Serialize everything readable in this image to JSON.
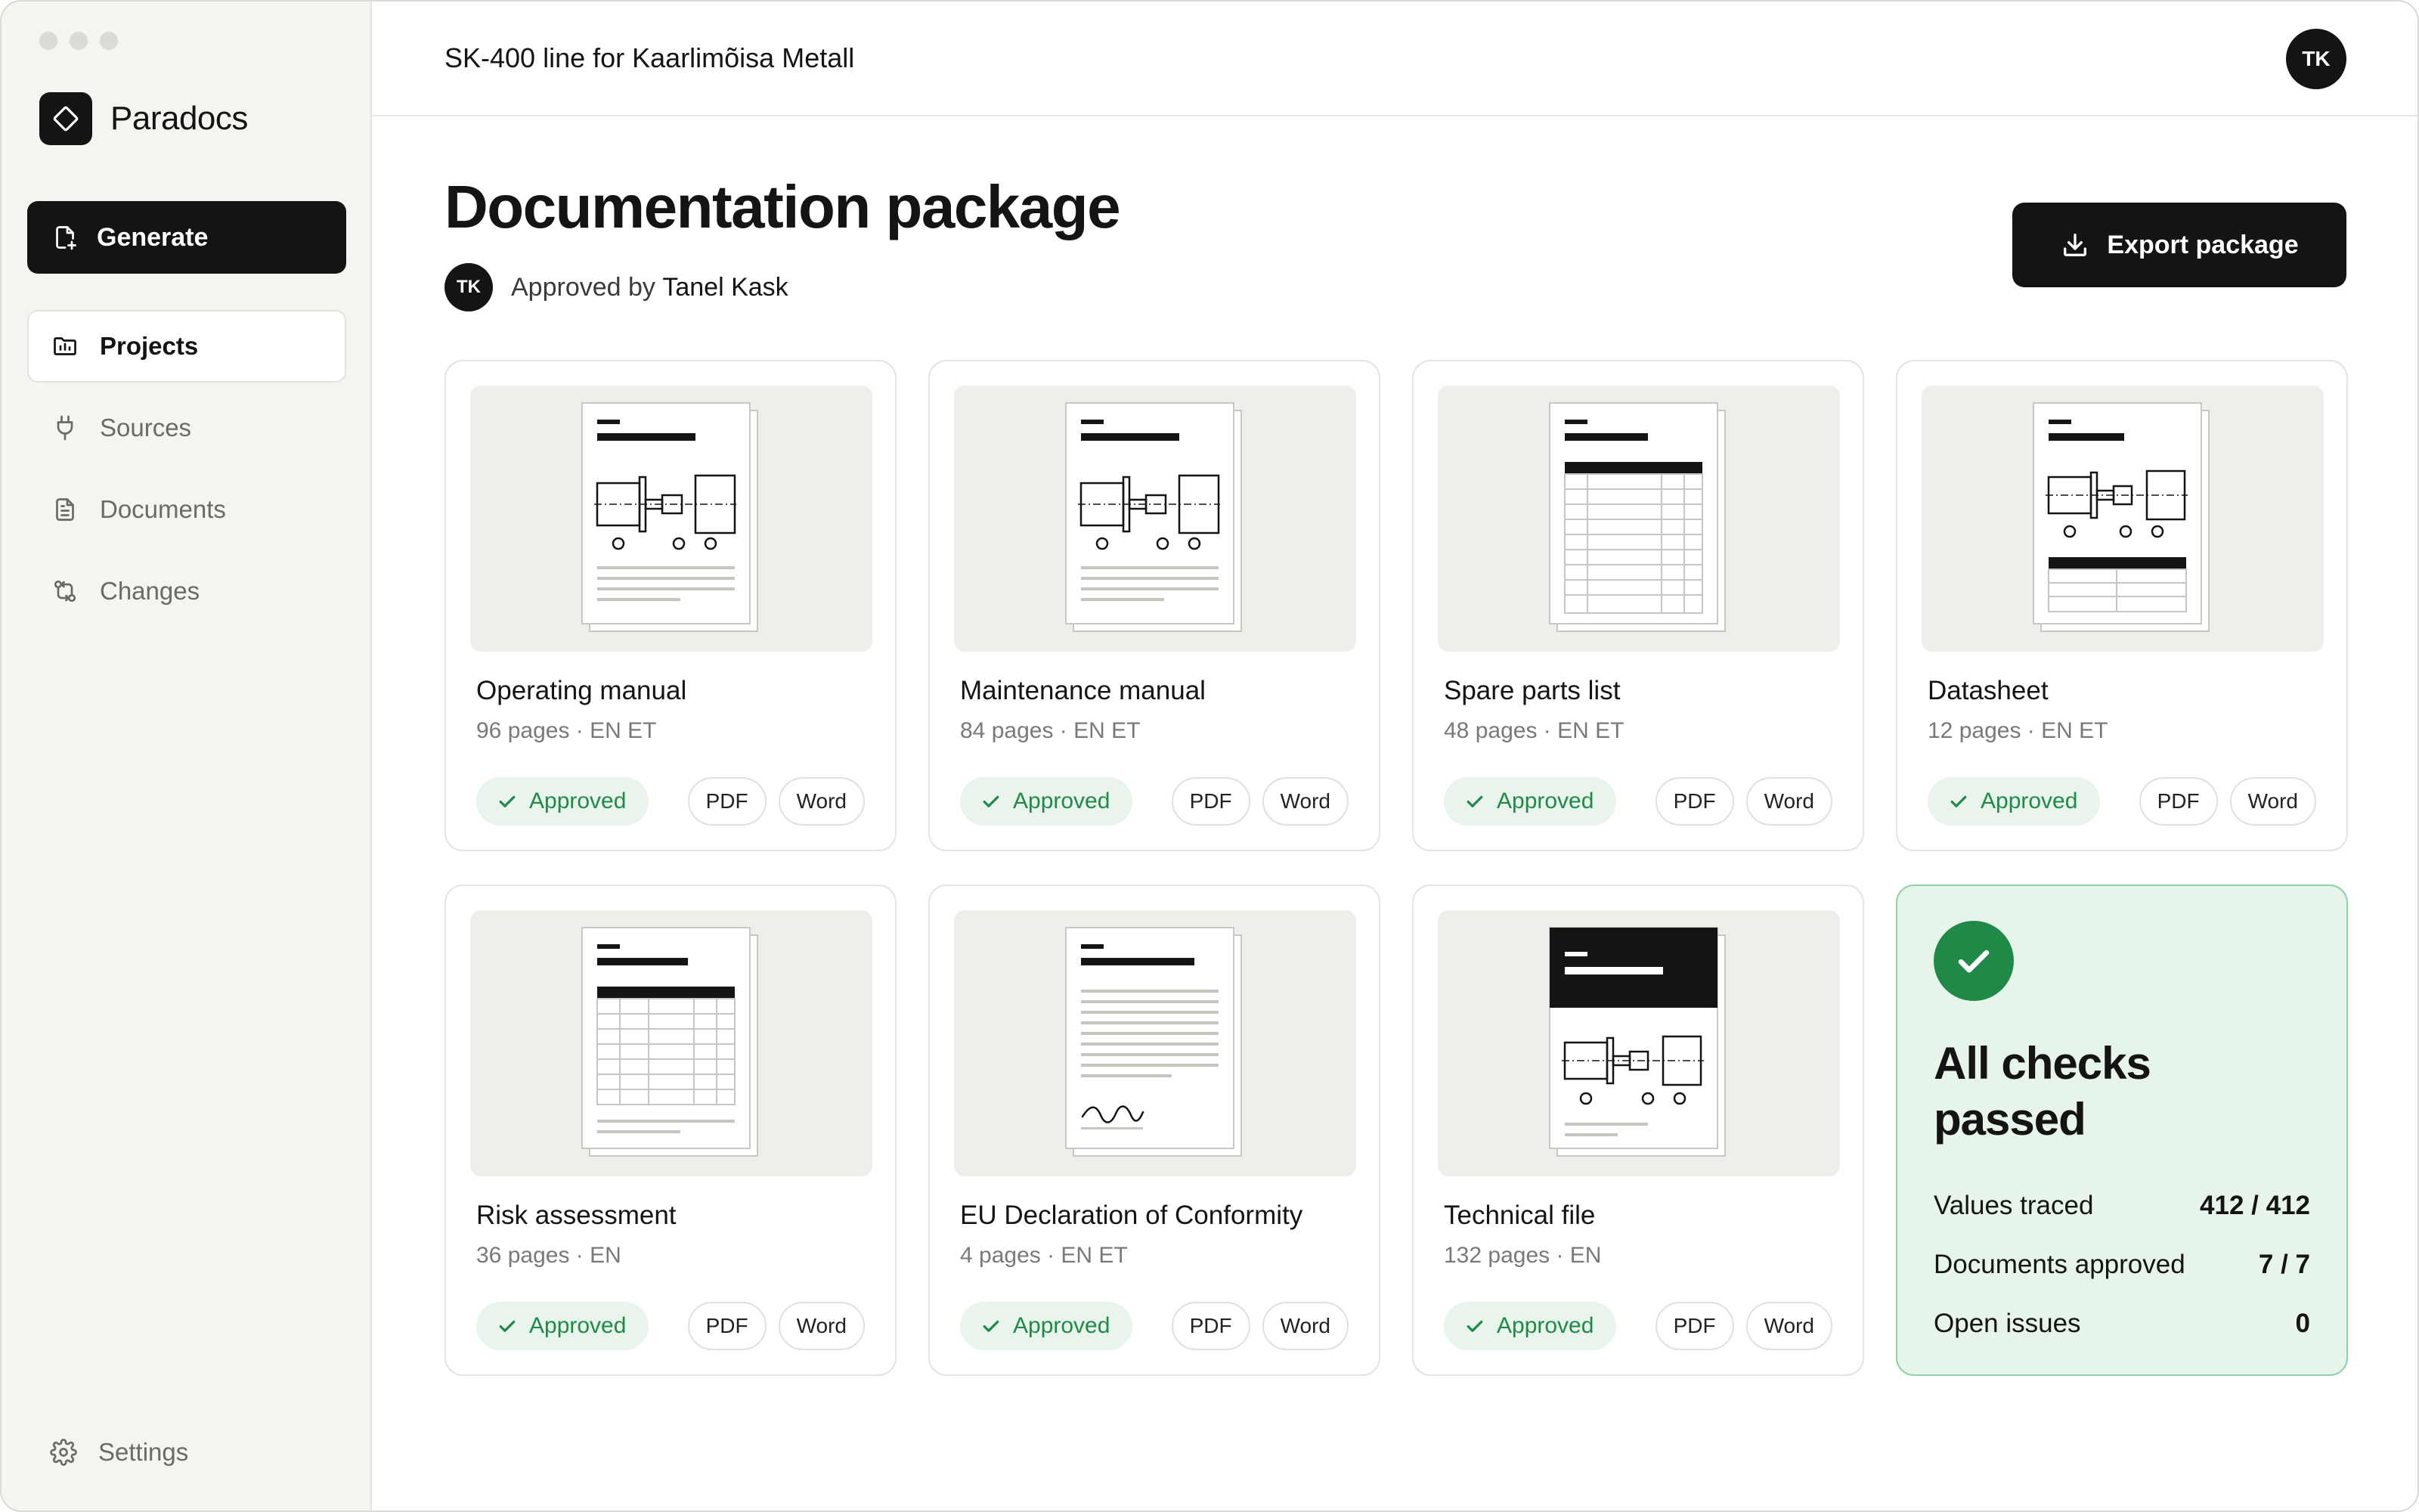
{
  "app": {
    "name": "Paradocs"
  },
  "sidebar": {
    "generate_label": "Generate",
    "items": [
      {
        "label": "Projects",
        "icon": "folder-chart-icon",
        "active": true
      },
      {
        "label": "Sources",
        "icon": "plug-icon",
        "active": false
      },
      {
        "label": "Documents",
        "icon": "document-icon",
        "active": false
      },
      {
        "label": "Changes",
        "icon": "git-compare-icon",
        "active": false
      }
    ],
    "settings_label": "Settings"
  },
  "header": {
    "project_title": "SK-400 line for Kaarlimõisa Metall",
    "user_initials": "TK"
  },
  "page": {
    "title": "Documentation package",
    "approved_prefix": "Approved by",
    "approver_initials": "TK",
    "approver_name": "Tanel Kask",
    "export_label": "Export package"
  },
  "documents": [
    {
      "title": "Operating manual",
      "meta": "96 pages · EN ET",
      "status": "Approved",
      "formats": [
        "PDF",
        "Word"
      ],
      "thumb": "machine-text"
    },
    {
      "title": "Maintenance manual",
      "meta": "84 pages · EN ET",
      "status": "Approved",
      "formats": [
        "PDF",
        "Word"
      ],
      "thumb": "machine-text"
    },
    {
      "title": "Spare parts list",
      "meta": "48 pages · EN ET",
      "status": "Approved",
      "formats": [
        "PDF",
        "Word"
      ],
      "thumb": "table"
    },
    {
      "title": "Datasheet",
      "meta": "12 pages · EN ET",
      "status": "Approved",
      "formats": [
        "PDF",
        "Word"
      ],
      "thumb": "machine-table"
    },
    {
      "title": "Risk assessment",
      "meta": "36 pages · EN",
      "status": "Approved",
      "formats": [
        "PDF",
        "Word"
      ],
      "thumb": "table-text"
    },
    {
      "title": "EU Declaration of Conformity",
      "meta": "4 pages · EN ET",
      "status": "Approved",
      "formats": [
        "PDF",
        "Word"
      ],
      "thumb": "signature"
    },
    {
      "title": "Technical file",
      "meta": "132 pages · EN",
      "status": "Approved",
      "formats": [
        "PDF",
        "Word"
      ],
      "thumb": "cover-machine"
    }
  ],
  "summary": {
    "title_line1": "All checks",
    "title_line2": "passed",
    "stats": [
      {
        "label": "Values traced",
        "value": "412 / 412"
      },
      {
        "label": "Documents approved",
        "value": "7 / 7"
      },
      {
        "label": "Open issues",
        "value": "0"
      }
    ]
  },
  "colors": {
    "accent": "#141414",
    "success": "#1f8a47",
    "success_bg": "#e9f4ec",
    "summary_bg": "#e7f4ea",
    "summary_border": "#8fd1a8"
  }
}
